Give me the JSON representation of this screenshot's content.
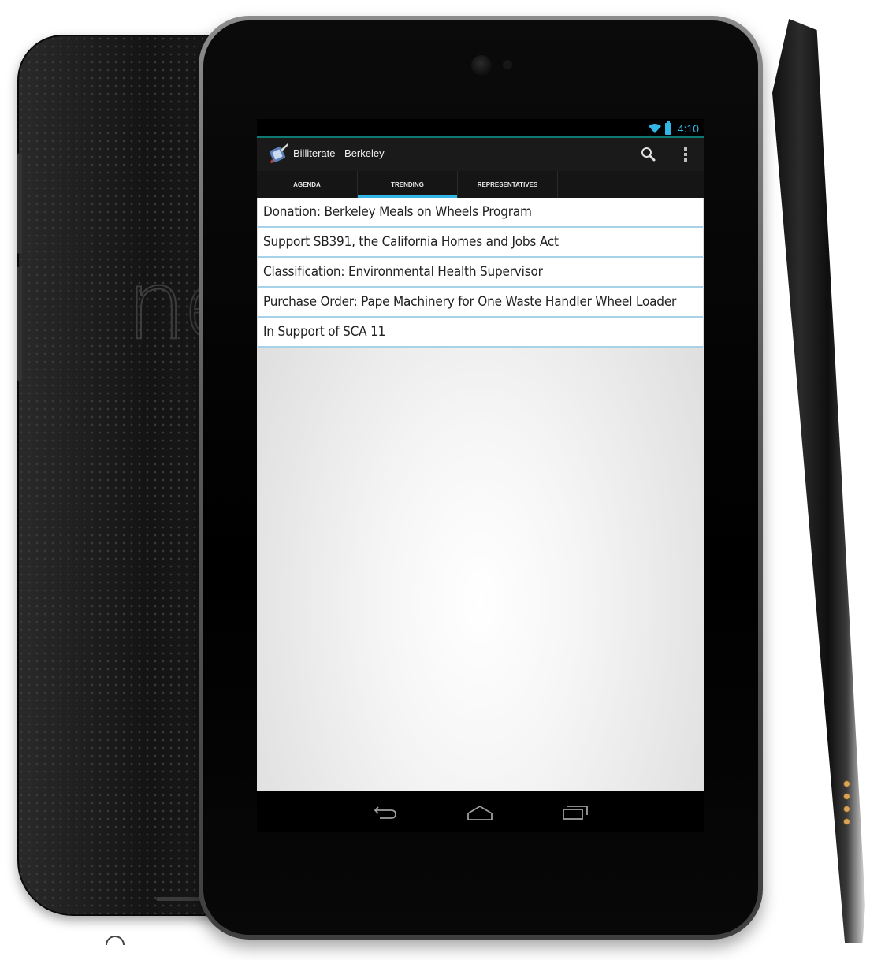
{
  "status_bar": {
    "time": "4:10",
    "icons": [
      "wifi-icon",
      "battery-icon"
    ],
    "accent_color": "#33b5e5"
  },
  "action_bar": {
    "app_icon": "billiterate-app-icon",
    "title": "Billiterate - Berkeley",
    "actions": [
      "search-icon",
      "overflow-menu-icon"
    ]
  },
  "tabs": [
    {
      "label": "AGENDA",
      "active": false
    },
    {
      "label": "TRENDING",
      "active": true
    },
    {
      "label": "REPRESENTATIVES",
      "active": false
    }
  ],
  "trending_items": [
    {
      "text": "Donation: Berkeley Meals on Wheels Program"
    },
    {
      "text": "Support SB391, the California Homes and Jobs Act"
    },
    {
      "text": "Classification: Environmental Health Supervisor"
    },
    {
      "text": "Purchase Order: Pape Machinery for One Waste Handler Wheel Loader"
    },
    {
      "text": "In Support of SCA 11"
    }
  ],
  "nav_bar": {
    "buttons": [
      "back-icon",
      "home-icon",
      "recent-apps-icon"
    ]
  },
  "device": {
    "back_logo_text": "nex"
  }
}
